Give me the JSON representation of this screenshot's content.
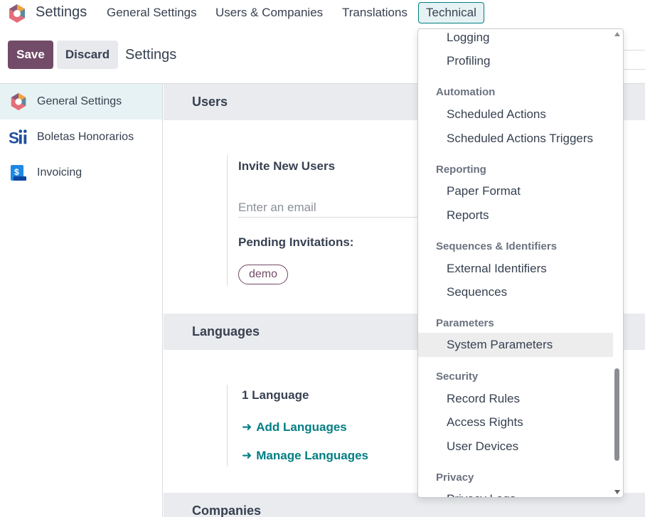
{
  "navbar": {
    "app_title": "Settings",
    "menu": [
      "General Settings",
      "Users & Companies",
      "Translations",
      "Technical"
    ],
    "active_menu": "Technical"
  },
  "control_panel": {
    "save_label": "Save",
    "discard_label": "Discard",
    "title": "Settings"
  },
  "sidebar": {
    "items": [
      {
        "label": "General Settings",
        "icon": "odoo-settings-icon",
        "active": true
      },
      {
        "label": "Boletas Honorarios",
        "icon": "sii-logo-icon",
        "active": false
      },
      {
        "label": "Invoicing",
        "icon": "invoicing-icon",
        "active": false
      }
    ]
  },
  "main": {
    "users": {
      "title": "Users",
      "invite_label": "Invite New Users",
      "email_placeholder": "Enter an email",
      "pending_label": "Pending Invitations:",
      "pending_tags": [
        "demo"
      ]
    },
    "languages": {
      "title": "Languages",
      "count_label": "1 Language",
      "add_link": "Add Languages",
      "manage_link": "Manage Languages"
    },
    "companies": {
      "title": "Companies"
    }
  },
  "dropdown": {
    "groups": [
      {
        "header": "",
        "items": [
          "Logging",
          "Profiling"
        ]
      },
      {
        "header": "Automation",
        "items": [
          "Scheduled Actions",
          "Scheduled Actions Triggers"
        ]
      },
      {
        "header": "Reporting",
        "items": [
          "Paper Format",
          "Reports"
        ]
      },
      {
        "header": "Sequences & Identifiers",
        "items": [
          "External Identifiers",
          "Sequences"
        ]
      },
      {
        "header": "Parameters",
        "items": [
          "System Parameters"
        ]
      },
      {
        "header": "Security",
        "items": [
          "Record Rules",
          "Access Rights",
          "User Devices"
        ]
      },
      {
        "header": "Privacy",
        "items": [
          "Privacy Logs"
        ]
      }
    ],
    "hovered_item": "System Parameters"
  },
  "colors": {
    "primary": "#714b67",
    "accent": "#017e84",
    "section_bg": "#e9ebee",
    "active_bg": "#e6f2f3"
  }
}
